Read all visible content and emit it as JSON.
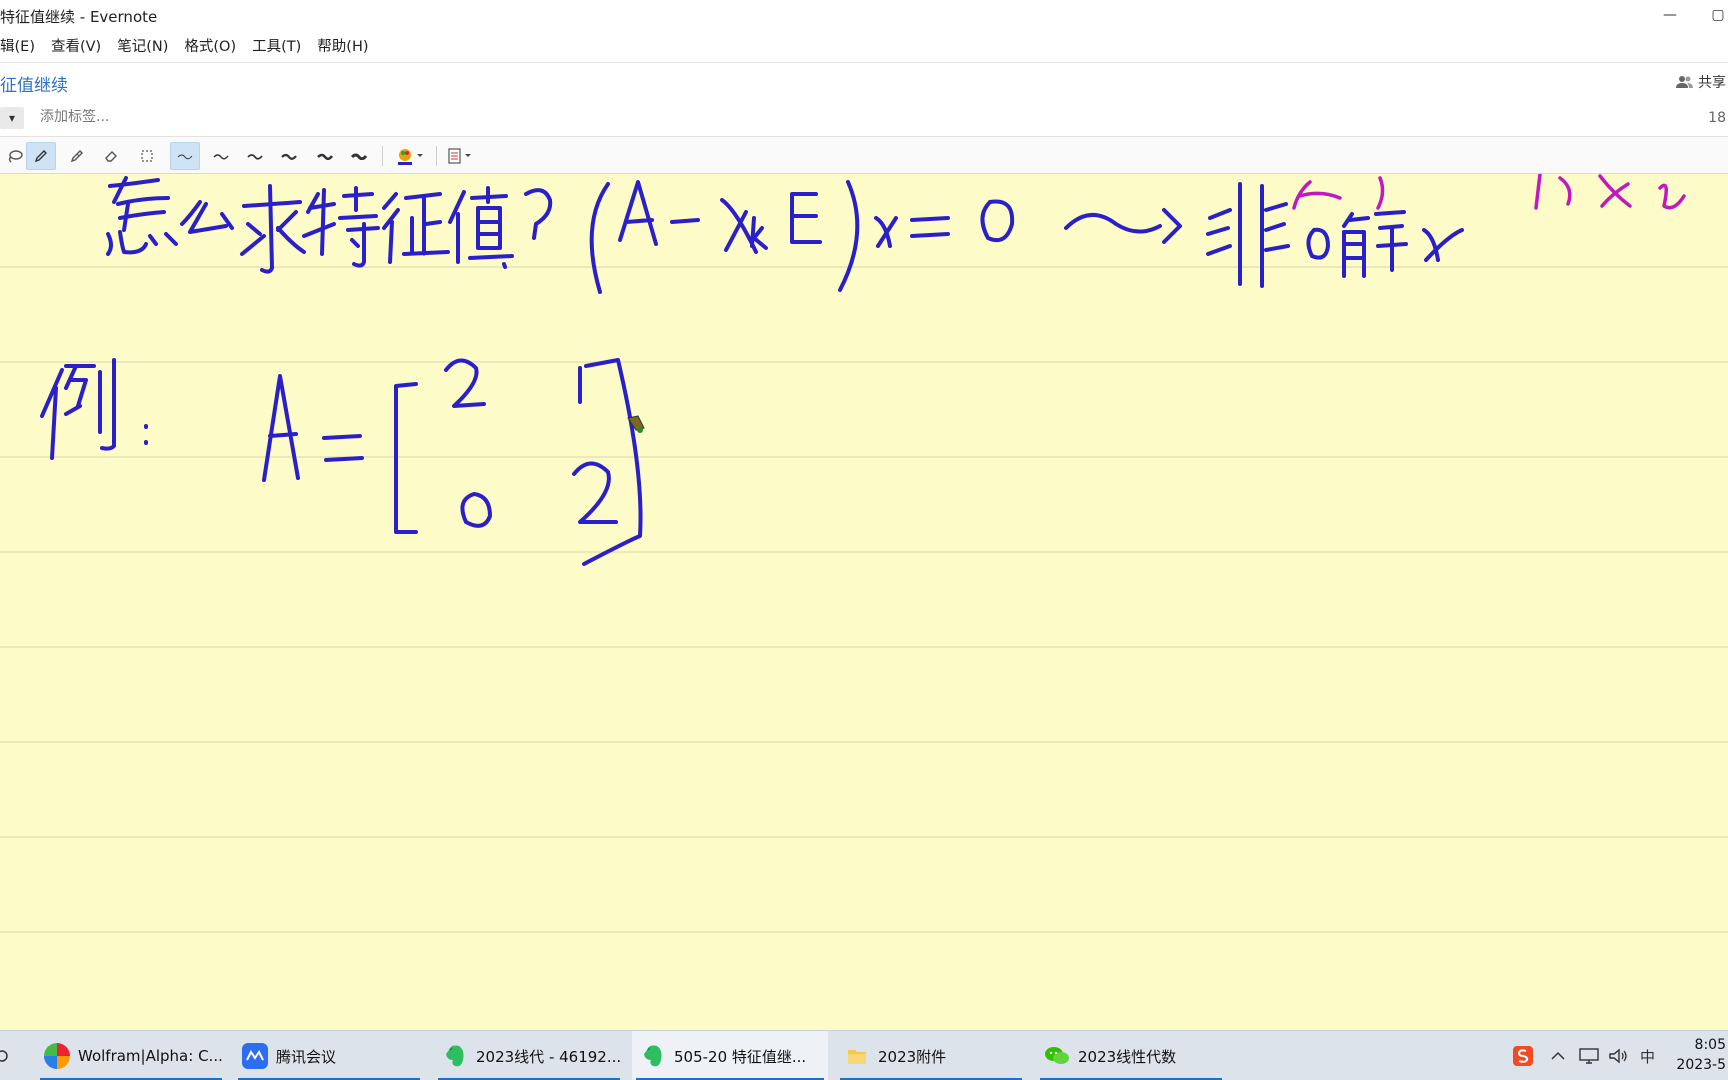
{
  "window": {
    "title": "特征值继续 - Evernote",
    "minimize_glyph": "—",
    "restore_glyph": "▢"
  },
  "menu": [
    "辑(E)",
    "查看(V)",
    "笔记(N)",
    "格式(O)",
    "工具(T)",
    "帮助(H)"
  ],
  "note": {
    "title": "征值继续",
    "share_label": "共享",
    "tag_placeholder": "添加标签...",
    "page_number": "18"
  },
  "toolbar": {
    "tools": [
      "lasso-icon",
      "pen-icon",
      "highlighter-icon",
      "eraser-icon",
      "selection-rect-icon",
      "stroke-1-icon",
      "stroke-2-icon",
      "stroke-3-icon",
      "stroke-4-icon",
      "stroke-5-icon",
      "stroke-6-icon",
      "color-picker-icon",
      "page-style-icon"
    ],
    "active_tools": [
      "pen-icon",
      "stroke-1-icon"
    ]
  },
  "colors": {
    "canvas": "#fdfbc8",
    "ink_blue": "#2a20c9",
    "ink_magenta": "#c218c0",
    "accent": "#1a73c9",
    "title_blue": "#2a73c7"
  },
  "handwriting": {
    "line1": "怎么求特征值？ (A-λₖE)x=0 ⟶ 非0解 x",
    "line2": "例： A = [2 1; 0 2]"
  },
  "taskbar": {
    "items": [
      {
        "label": "Wolfram|Alpha: C...",
        "icon": "wolfram-icon",
        "active": false
      },
      {
        "label": "腾讯会议",
        "icon": "tencent-meeting-icon",
        "active": false
      },
      {
        "label": "2023线代 - 46192...",
        "icon": "evernote-icon",
        "active": false
      },
      {
        "label": "505-20 特征值继...",
        "icon": "evernote-icon",
        "active": true
      },
      {
        "label": "2023附件",
        "icon": "folder-icon",
        "active": false
      },
      {
        "label": "2023线性代数",
        "icon": "wechat-icon",
        "active": false
      }
    ],
    "tray_icons": [
      "sogou-ime-icon",
      "chevron-up-icon",
      "network-icon",
      "volume-icon",
      "ime-icon"
    ],
    "ime_label": "中",
    "time": "8:05",
    "date": "2023-5"
  }
}
